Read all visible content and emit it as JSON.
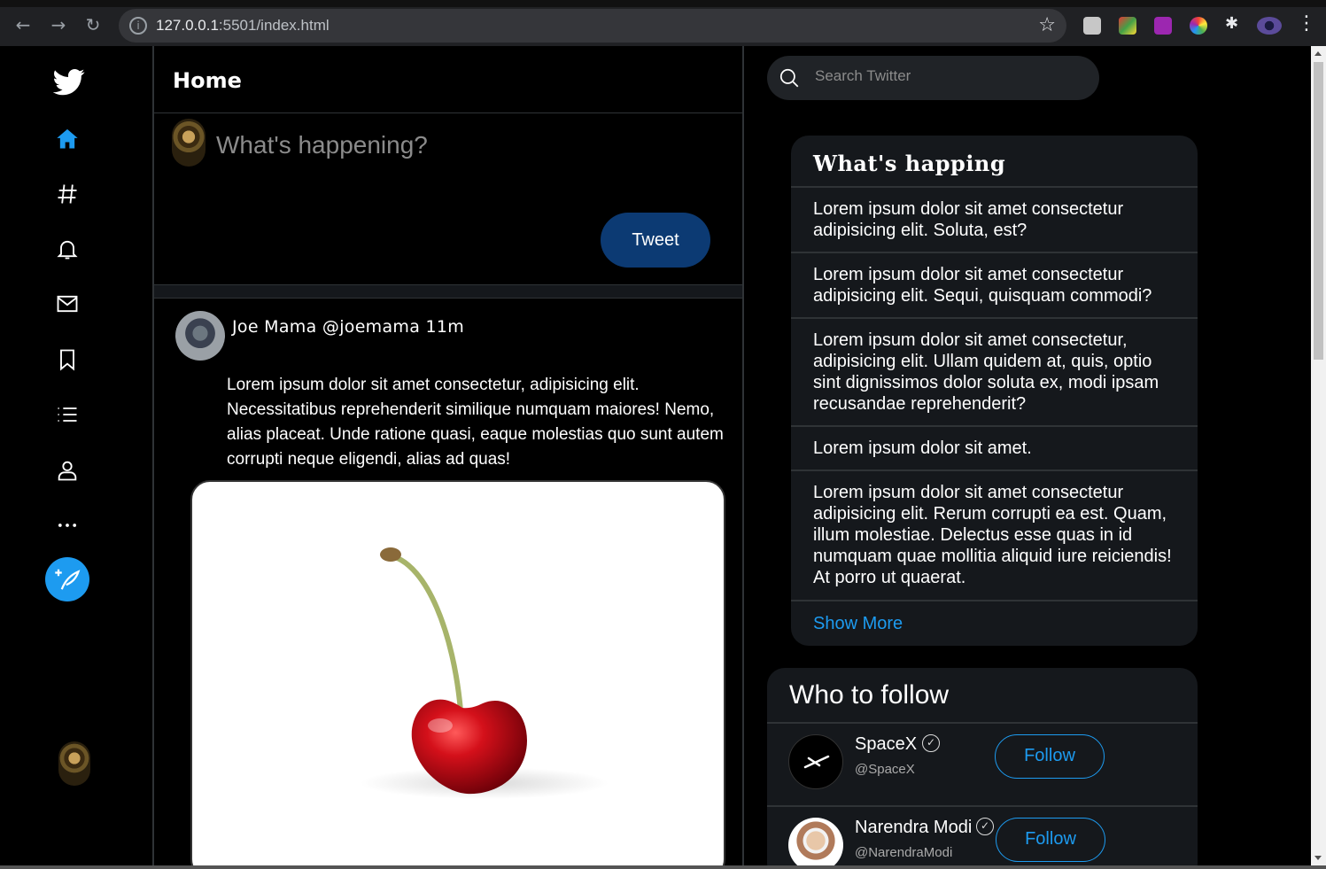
{
  "browser": {
    "url_host": "127.0.0.1",
    "url_rest": ":5501/index.html",
    "back_icon": "arrow-left-icon",
    "forward_icon": "arrow-right-icon",
    "reload_icon": "reload-icon"
  },
  "sidebar": {
    "items": [
      "home-icon",
      "hashtag-icon",
      "bell-icon",
      "mail-icon",
      "bookmark-icon",
      "list-icon",
      "profile-icon",
      "more-icon"
    ],
    "accent": "#1d9bf0"
  },
  "main": {
    "title": "Home",
    "compose_placeholder": "What's happening?",
    "tweet_button": "Tweet"
  },
  "tweet": {
    "name": "Joe Mama",
    "handle": "@joemama",
    "time": "11m",
    "body": "Lorem ipsum dolor sit amet consectetur, adipisicing elit. Necessitatibus reprehenderit similique numquam maiores! Nemo, alias placeat. Unde ratione quasi, eaque molestias quo sunt autem corrupti neque eligendi, alias ad quas!"
  },
  "search": {
    "placeholder": "Search Twitter"
  },
  "trends": {
    "title": "What's happing",
    "items": [
      "Lorem ipsum dolor sit amet consectetur adipisicing elit. Soluta, est?",
      "Lorem ipsum dolor sit amet consectetur adipisicing elit. Sequi, quisquam commodi?",
      "Lorem ipsum dolor sit amet consectetur, adipisicing elit. Ullam quidem at, quis, optio sint dignissimos dolor soluta ex, modi ipsam recusandae reprehenderit?",
      "Lorem ipsum dolor sit amet.",
      "Lorem ipsum dolor sit amet consectetur adipisicing elit. Rerum corrupti ea est. Quam, illum molestiae. Delectus esse quas in id numquam quae mollitia aliquid iure reiciendis! At porro ut quaerat."
    ],
    "show_more": "Show More"
  },
  "follow": {
    "title": "Who to follow",
    "accounts": [
      {
        "name": "SpaceX",
        "handle": "@SpaceX",
        "button": "Follow"
      },
      {
        "name": "Narendra Modi",
        "handle": "@NarendraModi",
        "button": "Follow"
      }
    ]
  }
}
